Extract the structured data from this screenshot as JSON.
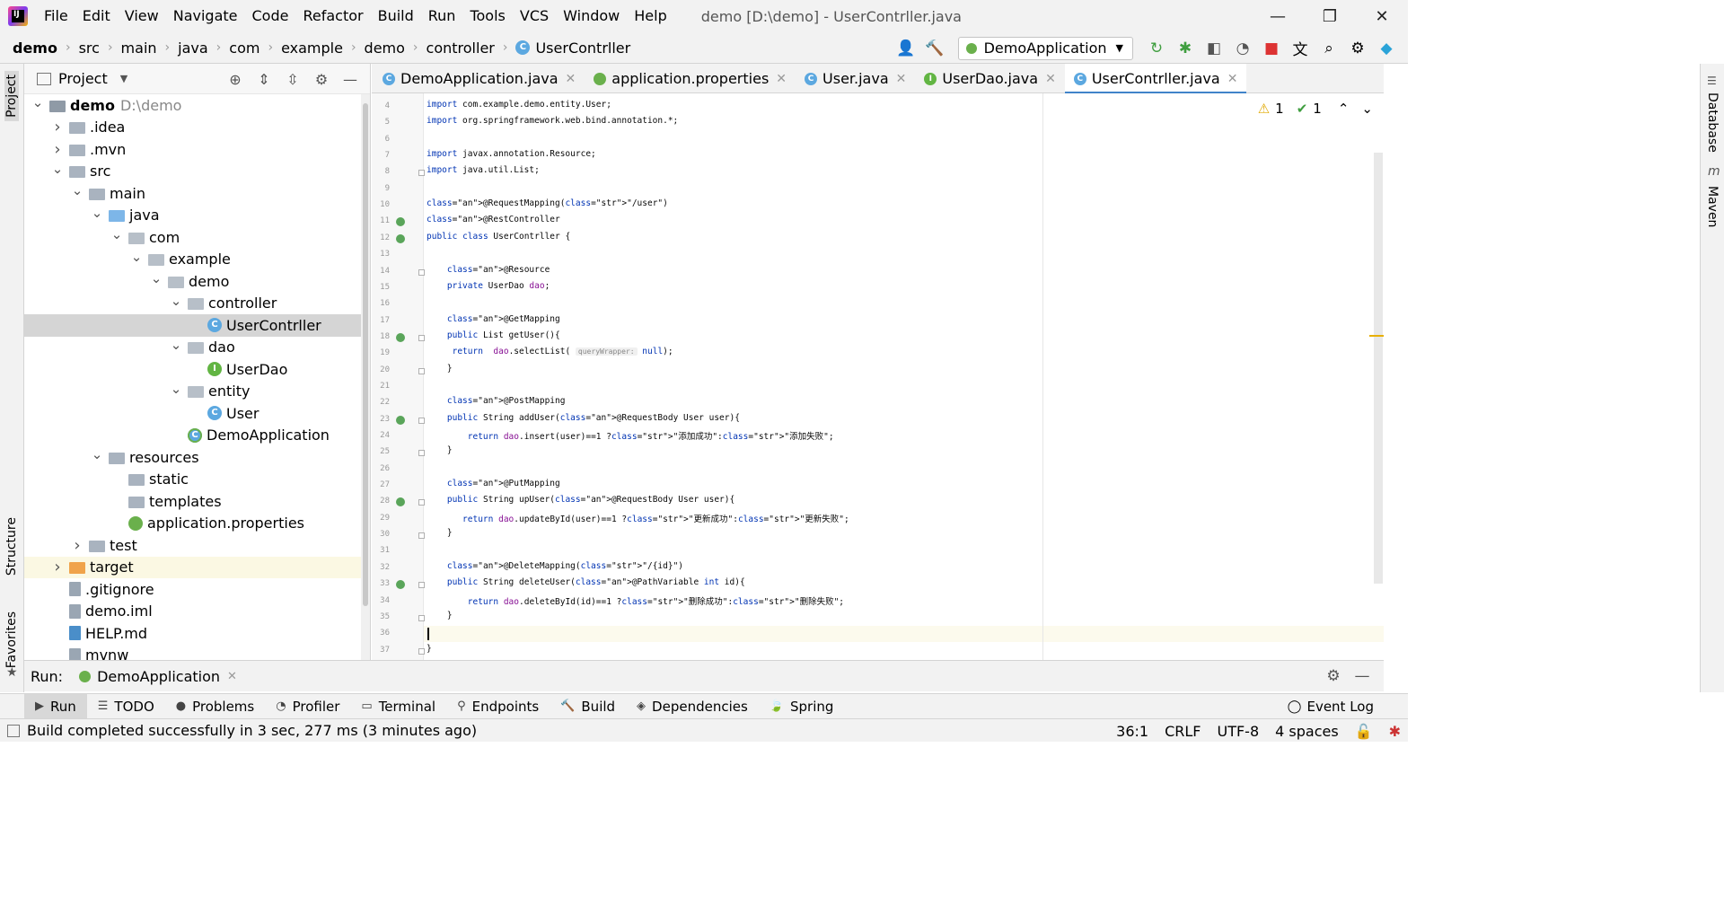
{
  "menubar": {
    "items": [
      "File",
      "Edit",
      "View",
      "Navigate",
      "Code",
      "Refactor",
      "Build",
      "Run",
      "Tools",
      "VCS",
      "Window",
      "Help"
    ],
    "title": "demo [D:\\demo] - UserContrller.java"
  },
  "breadcrumbs": [
    "demo",
    "src",
    "main",
    "java",
    "com",
    "example",
    "demo",
    "controller",
    "UserContrller"
  ],
  "toolbar": {
    "run_config": "DemoApplication"
  },
  "project": {
    "title": "Project",
    "tree": [
      {
        "label": "demo",
        "hint": "D:\\demo",
        "depth": 0,
        "icon": "module-folder-icon",
        "expanded": true,
        "bold": true
      },
      {
        "label": ".idea",
        "depth": 1,
        "icon": "folder-icon",
        "expanded": false
      },
      {
        "label": ".mvn",
        "depth": 1,
        "icon": "folder-icon",
        "expanded": false
      },
      {
        "label": "src",
        "depth": 1,
        "icon": "folder-icon",
        "expanded": true
      },
      {
        "label": "main",
        "depth": 2,
        "icon": "folder-icon",
        "expanded": true
      },
      {
        "label": "java",
        "depth": 3,
        "icon": "source-folder-icon",
        "expanded": true
      },
      {
        "label": "com",
        "depth": 4,
        "icon": "package-icon",
        "expanded": true
      },
      {
        "label": "example",
        "depth": 5,
        "icon": "package-icon",
        "expanded": true
      },
      {
        "label": "demo",
        "depth": 6,
        "icon": "package-icon",
        "expanded": true
      },
      {
        "label": "controller",
        "depth": 7,
        "icon": "package-icon",
        "expanded": true
      },
      {
        "label": "UserContrller",
        "depth": 8,
        "icon": "class-icon",
        "selected": true
      },
      {
        "label": "dao",
        "depth": 7,
        "icon": "package-icon",
        "expanded": true
      },
      {
        "label": "UserDao",
        "depth": 8,
        "icon": "interface-icon"
      },
      {
        "label": "entity",
        "depth": 7,
        "icon": "package-icon",
        "expanded": true
      },
      {
        "label": "User",
        "depth": 8,
        "icon": "class-icon"
      },
      {
        "label": "DemoApplication",
        "depth": 7,
        "icon": "spring-boot-class-icon"
      },
      {
        "label": "resources",
        "depth": 3,
        "icon": "resources-folder-icon",
        "expanded": true
      },
      {
        "label": "static",
        "depth": 4,
        "icon": "folder-icon"
      },
      {
        "label": "templates",
        "depth": 4,
        "icon": "folder-icon"
      },
      {
        "label": "application.properties",
        "depth": 4,
        "icon": "spring-properties-icon"
      },
      {
        "label": "test",
        "depth": 2,
        "icon": "folder-icon",
        "expanded": false
      },
      {
        "label": "target",
        "depth": 1,
        "icon": "excluded-folder-icon",
        "expanded": false,
        "highlight": true
      },
      {
        "label": ".gitignore",
        "depth": 1,
        "icon": "file-icon"
      },
      {
        "label": "demo.iml",
        "depth": 1,
        "icon": "file-icon"
      },
      {
        "label": "HELP.md",
        "depth": 1,
        "icon": "markdown-icon"
      },
      {
        "label": "mvnw",
        "depth": 1,
        "icon": "file-icon"
      }
    ]
  },
  "stripes": {
    "project": "Project",
    "structure": "Structure",
    "favorites": "Favorites",
    "database": "Database",
    "maven": "Maven"
  },
  "tabs": [
    {
      "label": "DemoApplication.java",
      "icon": "spring-boot-class-icon",
      "color": "#5ca8e0"
    },
    {
      "label": "application.properties",
      "icon": "spring-properties-icon",
      "color": "#6ab04c"
    },
    {
      "label": "User.java",
      "icon": "class-icon",
      "color": "#5ca8e0"
    },
    {
      "label": "UserDao.java",
      "icon": "interface-icon",
      "color": "#62b543"
    },
    {
      "label": "UserContrller.java",
      "icon": "class-icon",
      "color": "#5ca8e0",
      "active": true
    }
  ],
  "editor": {
    "inspections": {
      "warnings": "1",
      "ok": "1"
    },
    "line_numbers": [
      "4",
      "5",
      "6",
      "7",
      "8",
      "9",
      "10",
      "11",
      "12",
      "13",
      "14",
      "15",
      "16",
      "17",
      "18",
      "19",
      "20",
      "21",
      "22",
      "23",
      "24",
      "25",
      "26",
      "27",
      "28",
      "29",
      "30",
      "31",
      "32",
      "33",
      "34",
      "35",
      "36",
      "37"
    ],
    "code_lines": [
      "import com.example.demo.entity.User;",
      "import org.springframework.web.bind.annotation.*;",
      "",
      "import javax.annotation.Resource;",
      "import java.util.List;",
      "",
      "@RequestMapping(\"/user\")",
      "@RestController",
      "public class UserContrller {",
      "",
      "    @Resource",
      "    private UserDao dao;",
      "",
      "    @GetMapping",
      "    public List getUser(){",
      "     return  dao.selectList( queryWrapper: null);",
      "    }",
      "",
      "    @PostMapping",
      "    public String addUser(@RequestBody User user){",
      "        return dao.insert(user)==1 ?\"添加成功\":\"添加失败\";",
      "    }",
      "",
      "    @PutMapping",
      "    public String upUser(@RequestBody User user){",
      "       return dao.updateById(user)==1 ?\"更新成功\":\"更新失败\";",
      "    }",
      "",
      "    @DeleteMapping(\"/{id}\")",
      "    public String deleteUser(@PathVariable int id){",
      "        return dao.deleteById(id)==1 ?\"删除成功\":\"删除失败\";",
      "    }",
      "",
      "}"
    ]
  },
  "run": {
    "label": "Run:",
    "tab": "DemoApplication"
  },
  "bottom_tabs": [
    {
      "label": "Run",
      "icon": "run-icon",
      "active": true
    },
    {
      "label": "TODO",
      "icon": "todo-icon"
    },
    {
      "label": "Problems",
      "icon": "problems-icon"
    },
    {
      "label": "Profiler",
      "icon": "profiler-icon"
    },
    {
      "label": "Terminal",
      "icon": "terminal-icon"
    },
    {
      "label": "Endpoints",
      "icon": "endpoints-icon"
    },
    {
      "label": "Build",
      "icon": "build-icon"
    },
    {
      "label": "Dependencies",
      "icon": "dependencies-icon"
    },
    {
      "label": "Spring",
      "icon": "spring-icon"
    }
  ],
  "event_log": "Event Log",
  "status": {
    "message": "Build completed successfully in 3 sec, 277 ms (3 minutes ago)",
    "position": "36:1",
    "line_sep": "CRLF",
    "encoding": "UTF-8",
    "indent": "4 spaces"
  }
}
